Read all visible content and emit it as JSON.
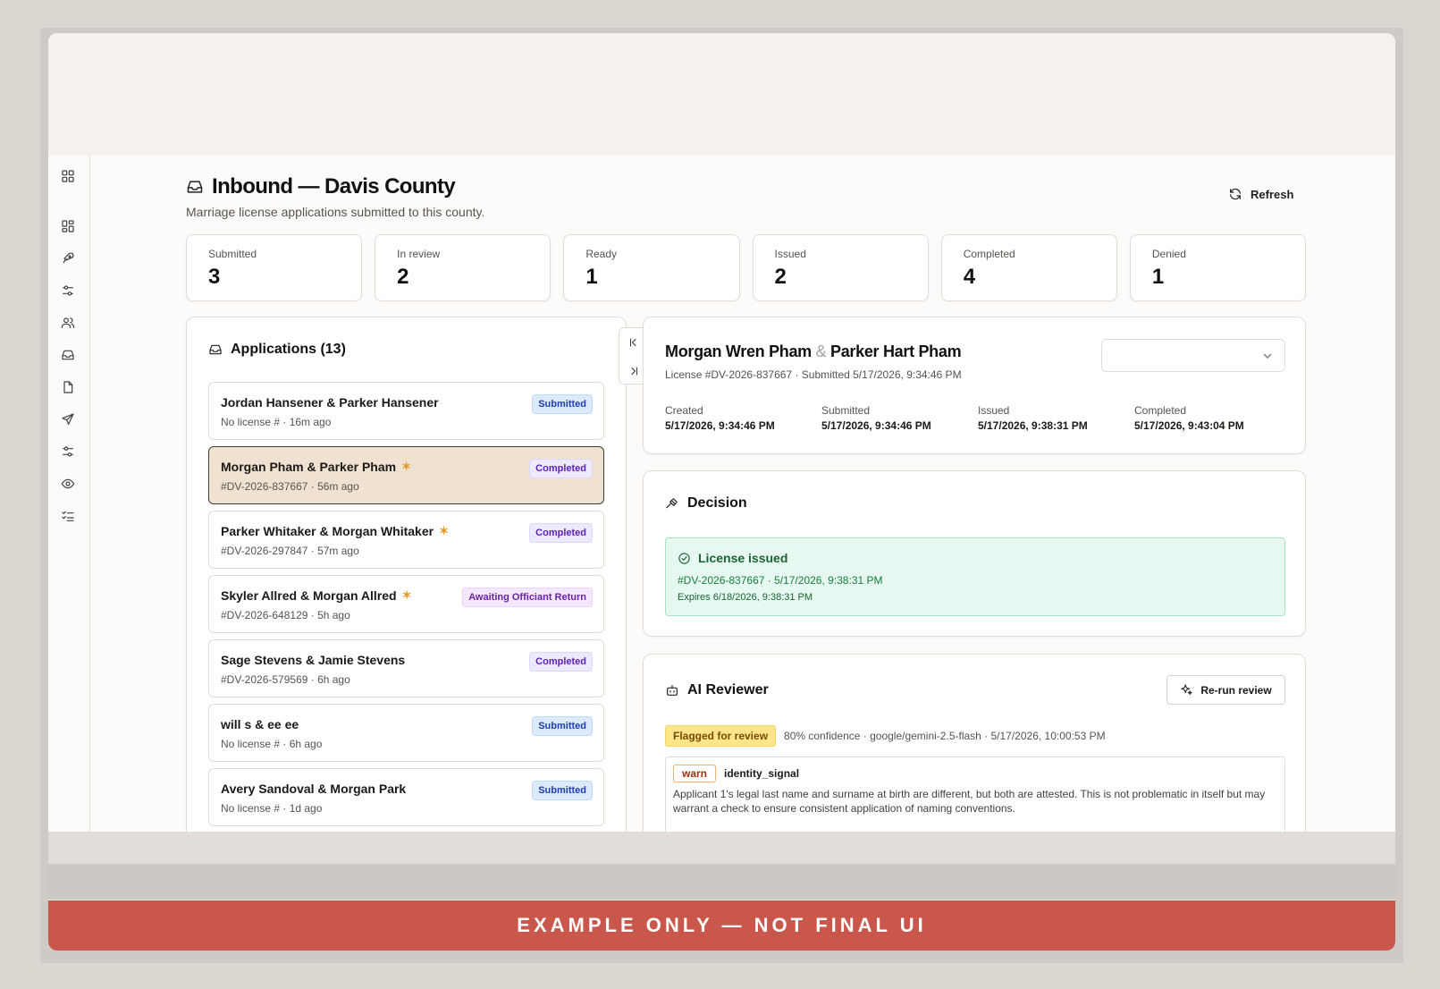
{
  "banner": "EXAMPLE ONLY — NOT FINAL UI",
  "header": {
    "title": "Inbound — Davis County",
    "subtitle": "Marriage license applications submitted to this county.",
    "refresh_label": "Refresh"
  },
  "stats": [
    {
      "label": "Submitted",
      "value": "3"
    },
    {
      "label": "In review",
      "value": "2"
    },
    {
      "label": "Ready",
      "value": "1"
    },
    {
      "label": "Issued",
      "value": "2"
    },
    {
      "label": "Completed",
      "value": "4"
    },
    {
      "label": "Denied",
      "value": "1"
    }
  ],
  "applications": {
    "title": "Applications (13)",
    "items": [
      {
        "name": "Jordan Hansener & Parker Hansener",
        "meta": "No license # · 16m ago",
        "status": "Submitted",
        "sparkle": false
      },
      {
        "name": "Morgan Pham & Parker Pham",
        "meta": "#DV-2026-837667 · 56m ago",
        "status": "Completed",
        "sparkle": true
      },
      {
        "name": "Parker Whitaker & Morgan Whitaker",
        "meta": "#DV-2026-297847 · 57m ago",
        "status": "Completed",
        "sparkle": true
      },
      {
        "name": "Skyler Allred & Morgan Allred",
        "meta": "#DV-2026-648129 · 5h ago",
        "status": "Awaiting Officiant Return",
        "sparkle": true
      },
      {
        "name": "Sage Stevens & Jamie Stevens",
        "meta": "#DV-2026-579569 · 6h ago",
        "status": "Completed",
        "sparkle": false
      },
      {
        "name": "will s & ee ee",
        "meta": "No license # · 6h ago",
        "status": "Submitted",
        "sparkle": false
      },
      {
        "name": "Avery Sandoval & Morgan Park",
        "meta": "No license # · 1d ago",
        "status": "Submitted",
        "sparkle": false
      }
    ]
  },
  "detail": {
    "name1": "Morgan Wren Pham",
    "amp": "&",
    "name2": "Parker Hart Pham",
    "license_line": "License #DV-2026-837667 · Submitted 5/17/2026, 9:34:46 PM",
    "dates": [
      {
        "label": "Created",
        "value": "5/17/2026, 9:34:46 PM"
      },
      {
        "label": "Submitted",
        "value": "5/17/2026, 9:34:46 PM"
      },
      {
        "label": "Issued",
        "value": "5/17/2026, 9:38:31 PM"
      },
      {
        "label": "Completed",
        "value": "5/17/2026, 9:43:04 PM"
      }
    ]
  },
  "decision": {
    "title": "Decision",
    "status_title": "License issued",
    "line": "#DV-2026-837667 · 5/17/2026, 9:38:31 PM",
    "expires": "Expires 6/18/2026, 9:38:31 PM"
  },
  "ai_reviewer": {
    "title": "AI Reviewer",
    "rerun_label": "Re-run review",
    "flag": "Flagged for review",
    "meta": "80% confidence · google/gemini-2.5-flash · 5/17/2026, 10:00:53 PM",
    "finding": {
      "level": "warn",
      "code": "identity_signal",
      "text": "Applicant 1's legal last name and surname at birth are different, but both are attested. This is not problematic in itself but may warrant a check to ensure consistent application of naming conventions."
    }
  },
  "colors": {
    "accent_selected": "#f0e2d1",
    "banner": "#c9574b",
    "success_bg": "#e6f8ef",
    "flag_bg": "#fde68a"
  }
}
